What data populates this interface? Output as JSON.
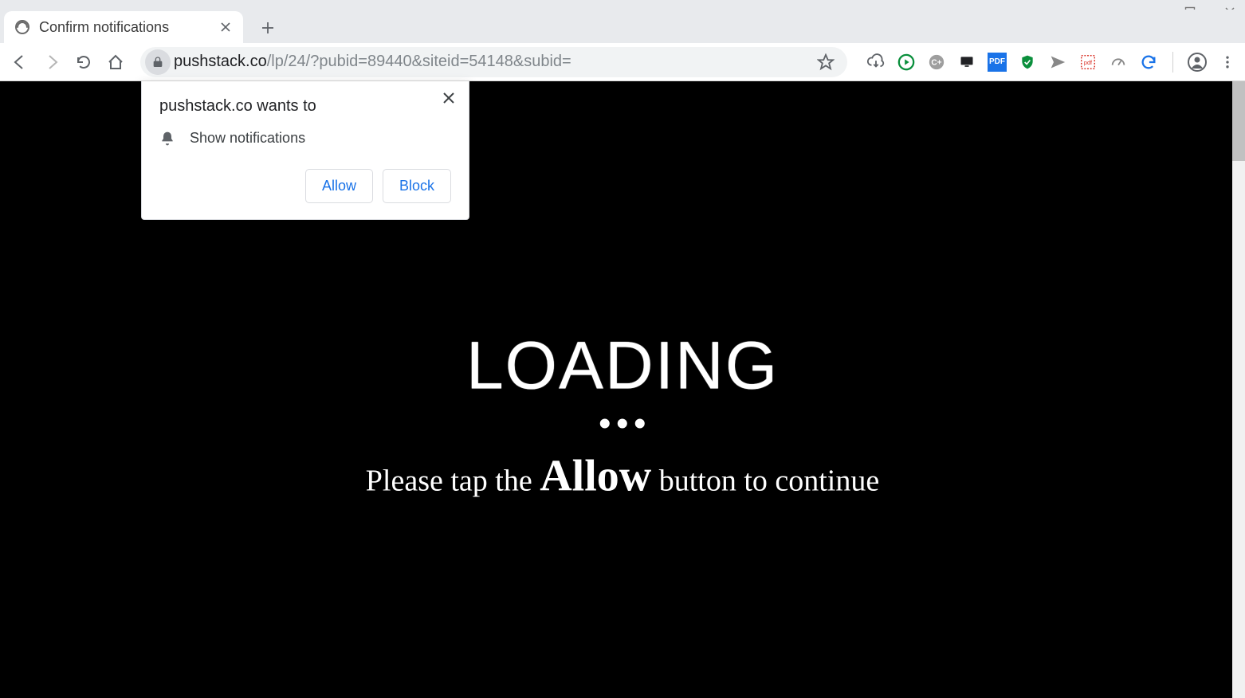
{
  "tab": {
    "title": "Confirm notifications"
  },
  "url": {
    "host": "pushstack.co",
    "path": "/lp/24/?pubid=89440&siteid=54148&subid="
  },
  "permission": {
    "requester": "pushstack.co wants to",
    "capability": "Show notifications",
    "allow": "Allow",
    "block": "Block"
  },
  "page": {
    "loading": "LOADING",
    "prompt_pre": "Please tap the ",
    "prompt_strong": "Allow",
    "prompt_post": " button to continue"
  },
  "ext_icons": {
    "pdf_label": "PDF"
  }
}
